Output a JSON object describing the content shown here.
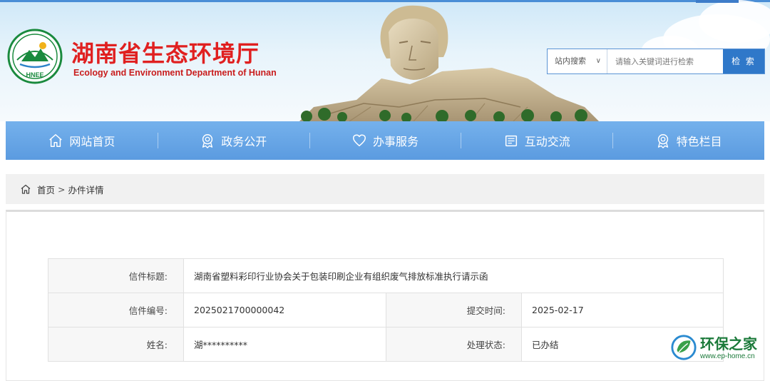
{
  "header": {
    "title": "湖南省生态环境厅",
    "subtitle": "Ecology and Environment Department of Hunan",
    "logo_text": "HNEE",
    "brand_color": "#e02020"
  },
  "search": {
    "scope": "站内搜索",
    "placeholder": "请输入关键词进行检索",
    "button": "检 索"
  },
  "nav": {
    "items": [
      {
        "label": "网站首页",
        "icon": "home-icon"
      },
      {
        "label": "政务公开",
        "icon": "badge-icon"
      },
      {
        "label": "办事服务",
        "icon": "heart-icon"
      },
      {
        "label": "互动交流",
        "icon": "document-icon"
      },
      {
        "label": "特色栏目",
        "icon": "badge-icon"
      }
    ],
    "color": "#5b9be0"
  },
  "breadcrumb": {
    "home": "首页",
    "separator": ">",
    "current": "办件详情"
  },
  "detail": {
    "title_label": "信件标题:",
    "title_value": "湖南省塑料彩印行业协会关于包装印刷企业有组织废气排放标准执行请示函",
    "number_label": "信件编号:",
    "number_value": "2025021700000042",
    "submit_label": "提交时间:",
    "submit_value": "2025-02-17",
    "name_label": "姓名:",
    "name_value": "湖**********",
    "status_label": "处理状态:",
    "status_value": "已办结"
  },
  "watermark": {
    "name": "环保之家",
    "url": "www.ep-home.cn"
  }
}
